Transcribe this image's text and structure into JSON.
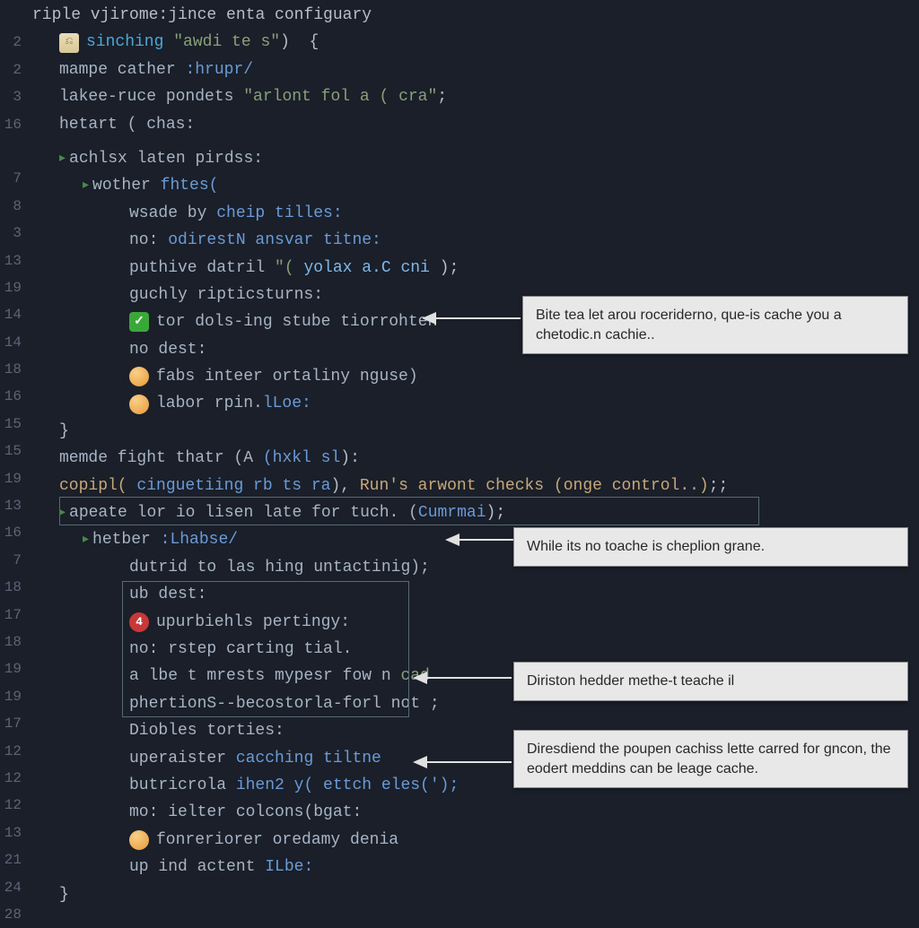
{
  "header": "riple vjirome:jince enta configuary",
  "gutter": [
    "",
    "2",
    "2",
    "3",
    "16",
    "",
    "7",
    "8",
    "3",
    "13",
    "19",
    "14",
    "14",
    "18",
    "16",
    "15",
    "15",
    "19",
    "13",
    "16",
    "7",
    "18",
    "17",
    "18",
    "19",
    "19",
    "17",
    "12",
    "12",
    "12",
    "13",
    "21",
    "24",
    "28"
  ],
  "lines": {
    "l1": {
      "kw": "sinching",
      "str": "\"awdi te s\"",
      "punc1": ")",
      "punc2": "{",
      "icon": "file"
    },
    "l2": {
      "a": "mampe cather ",
      "b": ":hrupr/"
    },
    "l3": {
      "a": "lakee-ruce pondets ",
      "str": "\"arlont fol a ( cra\"",
      "punc": ";"
    },
    "l4": {
      "a": "hetart ( chas:"
    },
    "l5": {
      "a": "achlsx laten pirdss:",
      "arrow": true
    },
    "l6": {
      "a": "wother ",
      "b": "fhtes(",
      "arrow": true
    },
    "l7": {
      "a": "wsade by ",
      "b": "cheip tilles:"
    },
    "l8": {
      "a": "no: ",
      "b": "odirestN ansvar titne:"
    },
    "l9": {
      "a": "puthive datril ",
      "b": "\"( ",
      "c": "yolax a.C cni",
      "d": " );"
    },
    "l10": {
      "a": "guchly ripticsturns:"
    },
    "l11": {
      "a": "tor dols-ing stube tiorrohten",
      "icon": "check"
    },
    "l12": {
      "a": "no dest:"
    },
    "l13": {
      "a": "fabs inteer ortaliny nguse)",
      "icon": "orange"
    },
    "l14": {
      "a": "labor rpin.",
      "b": "lLoe:",
      "icon": "orange"
    },
    "l15": {
      "a": "}"
    },
    "l16": {
      "a": "memde fight thatr (A ",
      "b": "(hxkl sl",
      "c": "):"
    },
    "l17": {
      "a": "copipl( ",
      "b": "cinguetiing rb ts ra",
      "c": "), ",
      "d": "Run's arwont checks (onge control..)",
      "e": ";;"
    },
    "l18": {
      "a": "apeate lor io lisen late for tuch. (",
      "b": "Cumrmai",
      "c": ");",
      "arrow": true
    },
    "l19": {
      "a": "hetber ",
      "b": ":Lhabse/",
      "arrow": true
    },
    "l20": {
      "a": "dutrid to las hing untactinig);"
    },
    "l21": {
      "a": "ub dest:"
    },
    "l22": {
      "a": "upurbiehls pertingy:",
      "icon": "red",
      "num": "4"
    },
    "l23": {
      "a": "no: ",
      "b": "rstep carting tial."
    },
    "l24": {
      "a": "a lbe t mrests mypesr fow n ",
      "b": "cad"
    },
    "l25": {
      "a": "phertionS--becostorla-forl ",
      "b": "not ;"
    },
    "l26": {
      "a": "Diobles torties:"
    },
    "l27": {
      "a": "uperaister ",
      "b": "cacching tiltne"
    },
    "l28": {
      "a": "butricrola ",
      "b": "ihen2 y( ettch eles(');",
      "c": ";"
    },
    "l29": {
      "a": "mo: ",
      "b": "ielter colcons(bgat:"
    },
    "l30": {
      "a": "fonreriorer oredamy denia",
      "icon": "orange"
    },
    "l31": {
      "a": "up ind actent ",
      "b": "ILbe:"
    },
    "l32": {
      "a": "}"
    }
  },
  "callouts": {
    "c1": "Bite tea let arou roceriderno, que-is cache you a chetodic.n cachie..",
    "c2": "While its no toache is cheplion grane.",
    "c3": "Diriston hedder methe-t teache il",
    "c4": "Diresdiend the poupen cachiss lette carred for gncon, the eodert meddins can be leage cache."
  }
}
